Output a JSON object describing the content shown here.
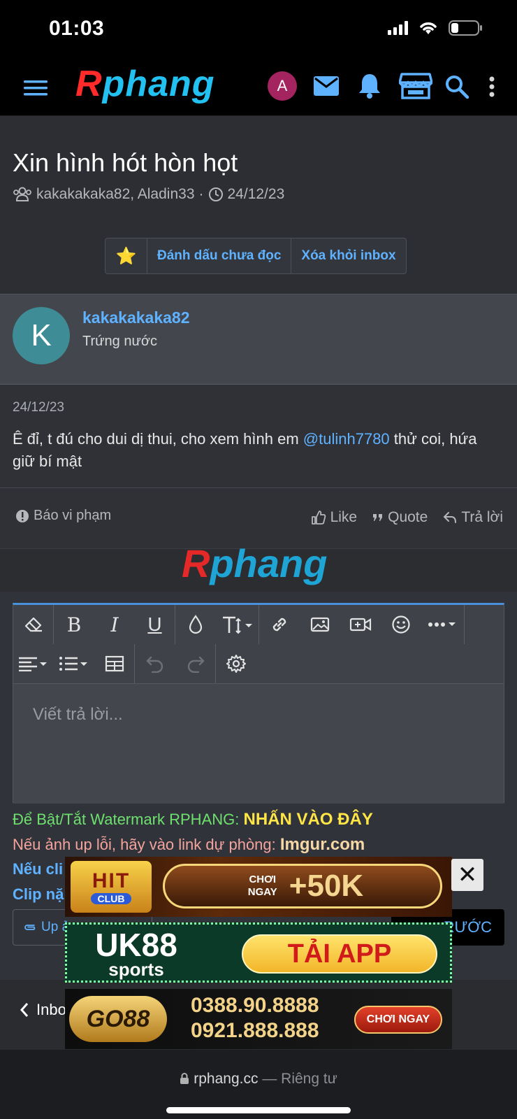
{
  "status": {
    "time": "01:03"
  },
  "nav": {
    "logo_first": "R",
    "logo_rest": "phang",
    "avatar_letter": "A"
  },
  "thread": {
    "title": "Xin hình hót hòn họt",
    "participants": "kakakakaka82, Aladin33",
    "separator": "·",
    "date": "24/12/23",
    "actions": {
      "mark_unread": "Đánh dấu chưa đọc",
      "remove_inbox": "Xóa khỏi inbox",
      "star": "⭐"
    }
  },
  "message": {
    "avatar_letter": "K",
    "username": "kakakakaka82",
    "user_title": "Trứng nước",
    "date": "24/12/23",
    "text_before": "Ê đỉ, t đú cho dui dị thui, cho xem hình em ",
    "mention": "@tulinh7780",
    "text_after": " thử coi, hứa giữ bí mật",
    "report": "Báo vi phạm",
    "like": "Like",
    "quote": "Quote",
    "reply": "Trả lời"
  },
  "mid_logo": {
    "first": "R",
    "rest": "phang"
  },
  "editor": {
    "placeholder": "Viết trả lời...",
    "notes": {
      "watermark_text": "Để Bật/Tắt Watermark RPHANG: ",
      "watermark_link": "NHẤN VÀO ĐÂY",
      "backup_text": "Nếu ảnh up lỗi, hãy vào link dự phòng: ",
      "backup_link": "Imgur.com",
      "line3": "Nếu cli",
      "line4": "Clip nặ"
    },
    "upload_label": "Up ả",
    "preview_label": "RƯỚC"
  },
  "bottom_nav": {
    "inbox": "Inbo"
  },
  "safari": {
    "domain": "rphang.cc",
    "suffix": " — Riêng tư"
  },
  "ads": {
    "ad1": {
      "brand": "HIT",
      "brand_sub": "CLUB",
      "cta_small": "CHƠI NGAY",
      "cta_big": "+50K"
    },
    "ad2": {
      "brand": "UK88",
      "brand_sub": "sports",
      "cta": "TẢI APP"
    },
    "ad3": {
      "brand": "GO88",
      "phone1": "0388.90.8888",
      "phone2": "0921.888.888",
      "cta": "CHƠI NGAY"
    },
    "close": "✕"
  },
  "colors": {
    "accent": "#5fb2ff",
    "bg": "#2c2e33",
    "brand_red": "#ff2a2a",
    "brand_blue": "#22c1f1"
  }
}
